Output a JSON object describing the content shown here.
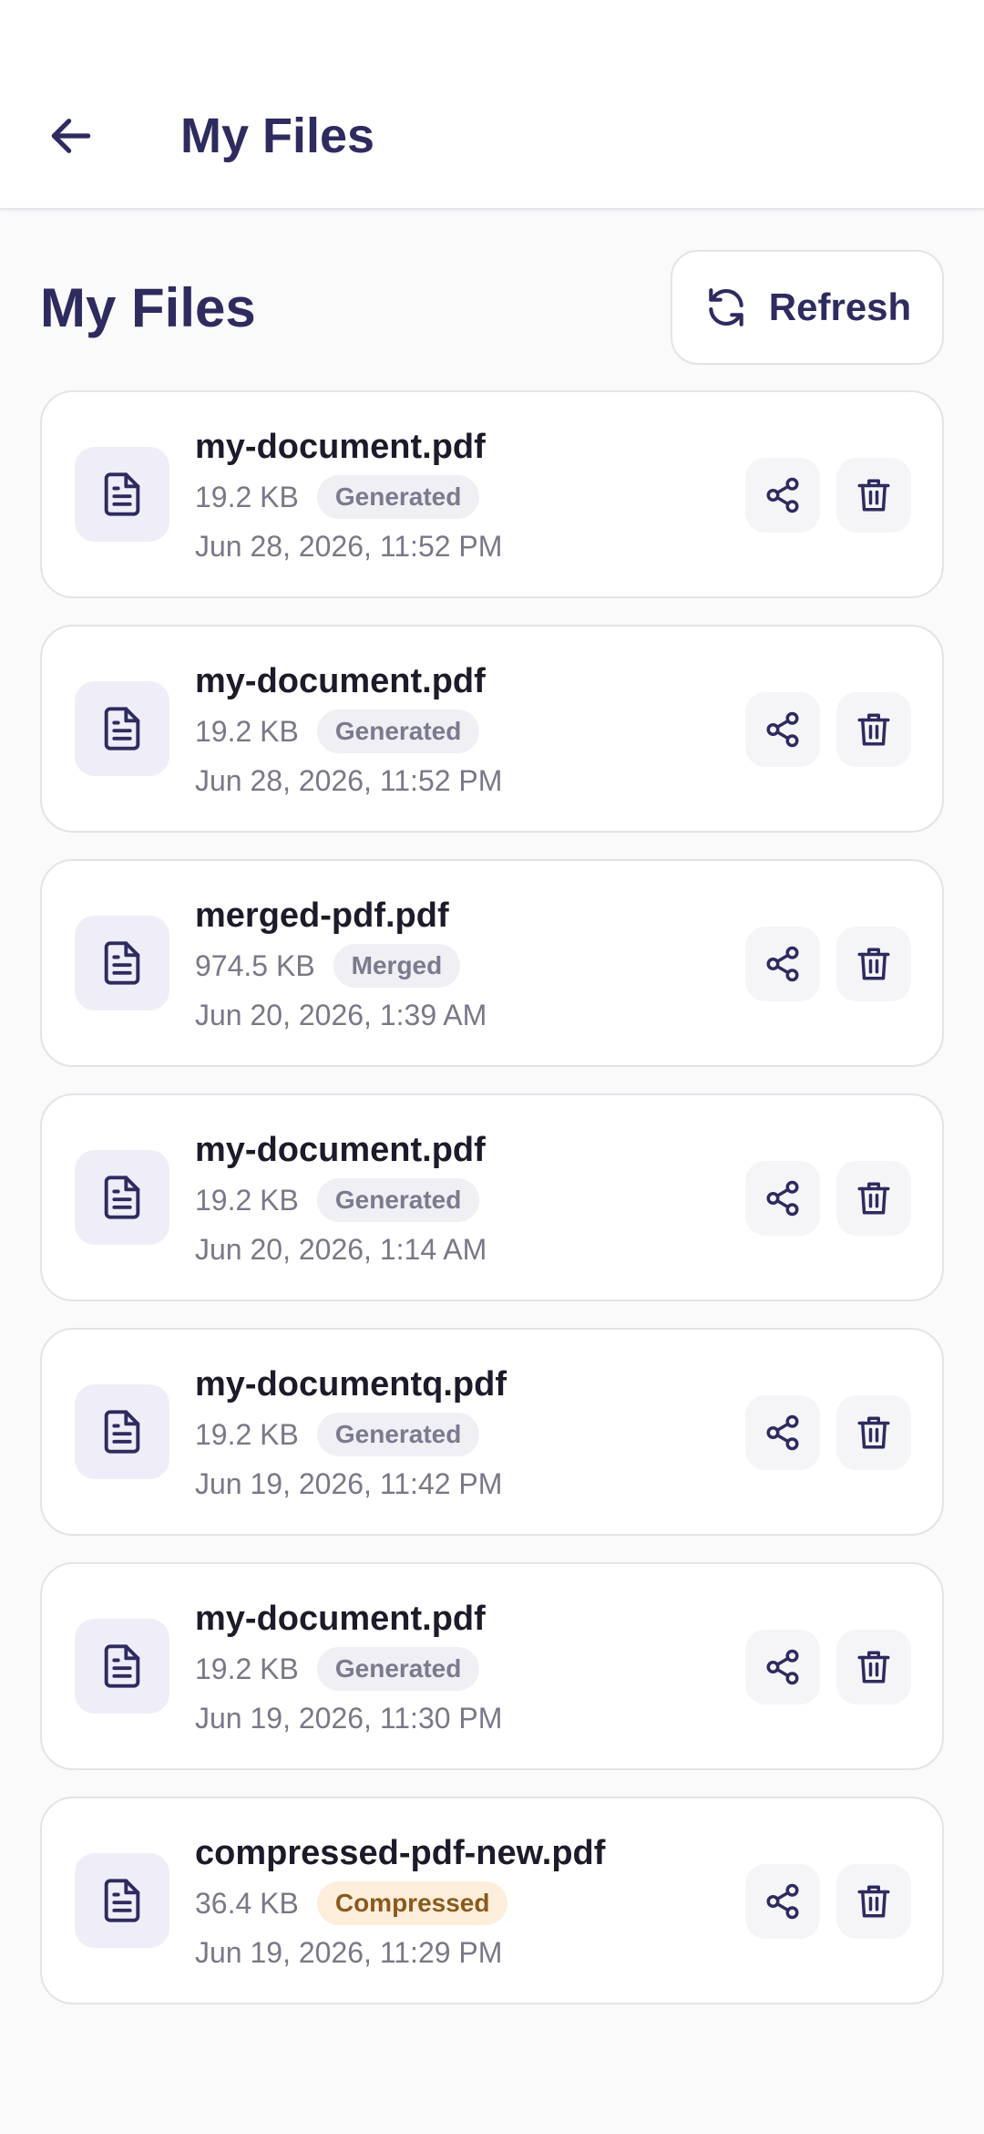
{
  "app_bar": {
    "title": "My Files"
  },
  "section": {
    "title": "My Files",
    "refresh_label": "Refresh"
  },
  "files": [
    {
      "name": "my-document.pdf",
      "size": "19.2 KB",
      "badge": "Generated",
      "badge_type": "generated",
      "date": "Jun 28, 2026, 11:52 PM"
    },
    {
      "name": "my-document.pdf",
      "size": "19.2 KB",
      "badge": "Generated",
      "badge_type": "generated",
      "date": "Jun 28, 2026, 11:52 PM"
    },
    {
      "name": "merged-pdf.pdf",
      "size": "974.5 KB",
      "badge": "Merged",
      "badge_type": "merged",
      "date": "Jun 20, 2026, 1:39 AM"
    },
    {
      "name": "my-document.pdf",
      "size": "19.2 KB",
      "badge": "Generated",
      "badge_type": "generated",
      "date": "Jun 20, 2026, 1:14 AM"
    },
    {
      "name": "my-documentq.pdf",
      "size": "19.2 KB",
      "badge": "Generated",
      "badge_type": "generated",
      "date": "Jun 19, 2026, 11:42 PM"
    },
    {
      "name": "my-document.pdf",
      "size": "19.2 KB",
      "badge": "Generated",
      "badge_type": "generated",
      "date": "Jun 19, 2026, 11:30 PM"
    },
    {
      "name": "compressed-pdf-new.pdf",
      "size": "36.4 KB",
      "badge": "Compressed",
      "badge_type": "compressed",
      "date": "Jun 19, 2026, 11:29 PM"
    }
  ],
  "colors": {
    "primary": "#2e2b5f",
    "card_border": "#e3e3e8",
    "icon_bg": "#efeef8",
    "badge_compressed_bg": "#fdeedb",
    "badge_compressed_text": "#8a5a1c"
  },
  "icons": {
    "back": "arrow-left-icon",
    "refresh": "refresh-icon",
    "file": "document-icon",
    "share": "share-icon",
    "delete": "trash-icon"
  }
}
